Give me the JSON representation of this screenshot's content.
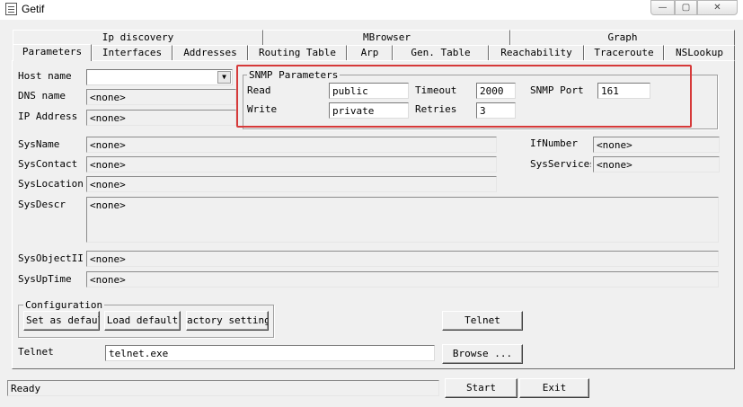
{
  "window": {
    "title": "Getif",
    "controls": {
      "minimize": "—",
      "maximize": "▢",
      "close": "✕"
    }
  },
  "tabs_back": [
    "Ip discovery",
    "MBrowser",
    "Graph"
  ],
  "tabs_front": [
    "Parameters",
    "Interfaces",
    "Addresses",
    "Routing Table",
    "Arp",
    "Gen. Table",
    "Reachability",
    "Traceroute",
    "NSLookup"
  ],
  "host": {
    "host_name_label": "Host name",
    "host_name_value": "",
    "dns_name_label": "DNS name",
    "dns_name_value": "<none>",
    "ip_address_label": "IP Address",
    "ip_address_value": "<none>"
  },
  "snmp": {
    "group_title": "SNMP Parameters",
    "read_label": "Read",
    "read_value": "public",
    "write_label": "Write",
    "write_value": "private",
    "timeout_label": "Timeout",
    "timeout_value": "2000",
    "retries_label": "Retries",
    "retries_value": "3",
    "port_label": "SNMP Port",
    "port_value": "161",
    "highlight_color": "#d63a3a"
  },
  "system": {
    "sysname_label": "SysName",
    "sysname_value": "<none>",
    "syscontact_label": "SysContact",
    "syscontact_value": "<none>",
    "syslocation_label": "SysLocation",
    "syslocation_value": "<none>",
    "sysdescr_label": "SysDescr",
    "sysdescr_value": "<none>",
    "sysobjectid_label": "SysObjectII",
    "sysobjectid_value": "<none>",
    "sysuptime_label": "SysUpTime",
    "sysuptime_value": "<none>",
    "ifnumber_label": "IfNumber",
    "ifnumber_value": "<none>",
    "sysservices_label": "SysServices",
    "sysservices_value": "<none>"
  },
  "configuration": {
    "group_title": "Configuration",
    "set_default_label": "Set as default",
    "load_default_label": "Load default",
    "factory_label": "actory setting"
  },
  "telnet": {
    "label": "Telnet",
    "path_value": "telnet.exe",
    "browse_label": "Browse ...",
    "telnet_button_label": "Telnet"
  },
  "footer": {
    "status_text": "Ready",
    "start_label": "Start",
    "exit_label": "Exit"
  }
}
